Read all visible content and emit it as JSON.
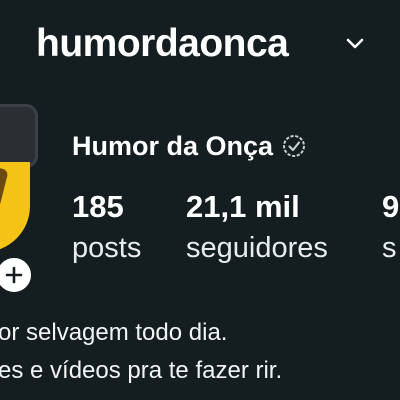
{
  "header": {
    "username": "humordaonca",
    "account_switch_icon": "chevron-down-icon"
  },
  "profile": {
    "display_name": "Humor da Onça",
    "verified_icon": "verified-badge-icon",
    "add_story_icon": "plus-icon",
    "stats": [
      {
        "value": "185",
        "label": "posts"
      },
      {
        "value": "21,1 mil",
        "label": "seguidores"
      },
      {
        "value": "9",
        "label": "s"
      }
    ],
    "bio_lines": [
      "or selvagem todo dia.",
      "es e vídeos pra te fazer rir."
    ]
  },
  "colors": {
    "background": "#141d1f",
    "text": "#ffffff",
    "avatar_yellow": "#f5c316"
  }
}
